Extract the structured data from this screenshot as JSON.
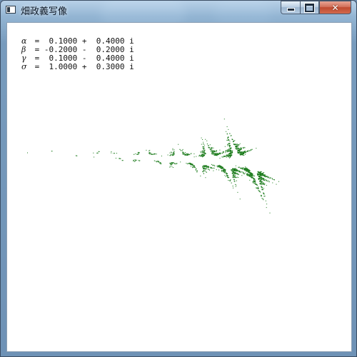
{
  "window": {
    "title": "畑政義写像",
    "icon": "app-window-icon",
    "buttons": {
      "minimize": "minimize",
      "maximize": "maximize",
      "close": "close"
    }
  },
  "parameters": [
    {
      "symbol": "α",
      "value": " =  0.1000 +  0.4000 i"
    },
    {
      "symbol": "β",
      "value": " = -0.2000 -  0.2000 i"
    },
    {
      "symbol": "γ",
      "value": " =  0.1000 -  0.4000 i"
    },
    {
      "symbol": "σ",
      "value": " =  1.0000 +  0.3000 i"
    }
  ],
  "colors": {
    "fractal": "#1a7a1a",
    "client_bg": "#ffffff",
    "close_button": "#c94a30"
  },
  "fractal": {
    "map": "Hata map",
    "alpha": [
      0.1,
      0.4
    ],
    "beta": [
      -0.2,
      -0.2
    ],
    "gamma": [
      0.1,
      -0.4
    ],
    "sigma": [
      1.0,
      0.3
    ]
  }
}
